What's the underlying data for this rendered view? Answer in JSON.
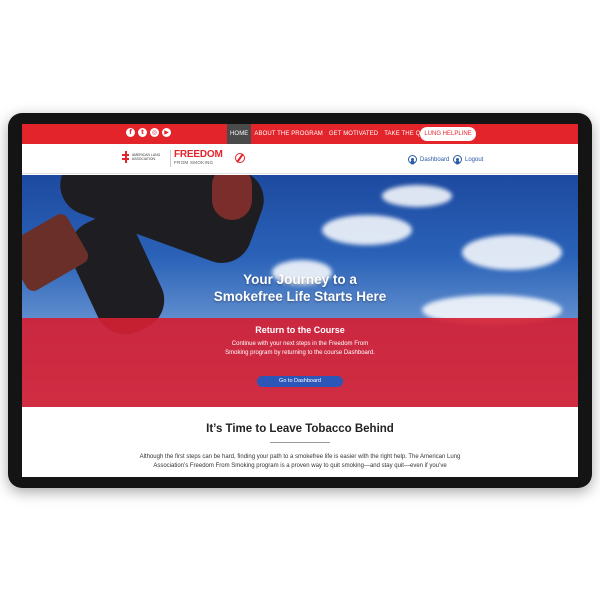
{
  "topbar": {
    "social": [
      {
        "icon": "facebook-icon",
        "glyph": "f"
      },
      {
        "icon": "twitter-icon",
        "glyph": "t"
      },
      {
        "icon": "instagram-icon",
        "glyph": "◎"
      },
      {
        "icon": "youtube-icon",
        "glyph": "▶"
      }
    ],
    "nav": [
      "HOME",
      "ABOUT THE PROGRAM",
      "GET MOTIVATED",
      "TAKE THE QUIZ"
    ],
    "helpline": "LUNG HELPLINE"
  },
  "header": {
    "ala_logo": "American Lung Association.",
    "ffs_title": "FREEDOM",
    "ffs_subtitle": "FROM SMOKING",
    "dashboard": "Dashboard",
    "logout": "Logout"
  },
  "hero": {
    "title_line1": "Your Journey to a",
    "title_line2": "Smokefree Life Starts Here"
  },
  "course": {
    "title": "Return to the Course",
    "body": "Continue with your next steps in the Freedom From Smoking program by returning to the course Dashboard.",
    "button": "Go to Dashboard"
  },
  "content": {
    "title": "It’s Time to Leave Tobacco Behind",
    "body": "Although the first steps can be hard, finding your path to a smokefree life is easier with the right help. The American Lung Association’s Freedom From Smoking program is a proven way to quit smoking—and stay quit—even if you’ve"
  },
  "colors": {
    "brand_red": "#e3242b",
    "active_nav": "#4a4a4a",
    "link_blue": "#2a5aa8",
    "button_blue": "#2c57b8"
  }
}
